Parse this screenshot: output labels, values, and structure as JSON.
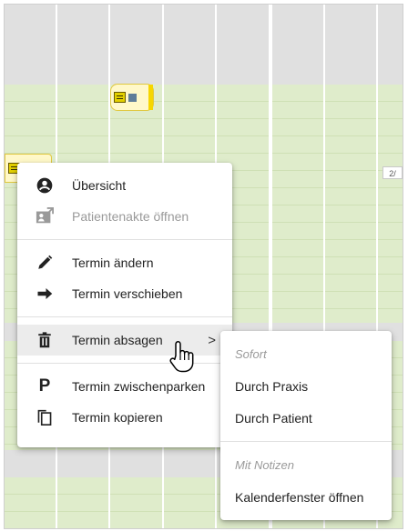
{
  "calendar": {
    "colors": {
      "gray": "#e0e0e0",
      "green": "#dfeccb",
      "chip": "#fff8c9",
      "chip_stripe": "#f6d600"
    },
    "edge_label": "2/"
  },
  "context_menu": {
    "items": [
      {
        "label": "Übersicht",
        "icon": "account-circle-icon",
        "enabled": true
      },
      {
        "label": "Patientenakte öffnen",
        "icon": "open-in-new-window-icon",
        "enabled": false
      },
      {
        "label": "Termin ändern",
        "icon": "pencil-icon",
        "enabled": true
      },
      {
        "label": "Termin verschieben",
        "icon": "arrow-right-icon",
        "enabled": true
      },
      {
        "label": "Termin absagen",
        "icon": "trash-icon",
        "enabled": true,
        "has_submenu": true,
        "hovered": true
      },
      {
        "label": "Termin zwischenparken",
        "icon": "parking-p-icon",
        "enabled": true
      },
      {
        "label": "Termin kopieren",
        "icon": "copy-icon",
        "enabled": true
      }
    ]
  },
  "submenu": {
    "items": [
      {
        "label": "Sofort",
        "enabled": false
      },
      {
        "label": "Durch Praxis",
        "enabled": true
      },
      {
        "label": "Durch Patient",
        "enabled": true
      },
      {
        "label": "Mit Notizen",
        "enabled": false
      },
      {
        "label": "Kalenderfenster öffnen",
        "enabled": true
      }
    ]
  }
}
